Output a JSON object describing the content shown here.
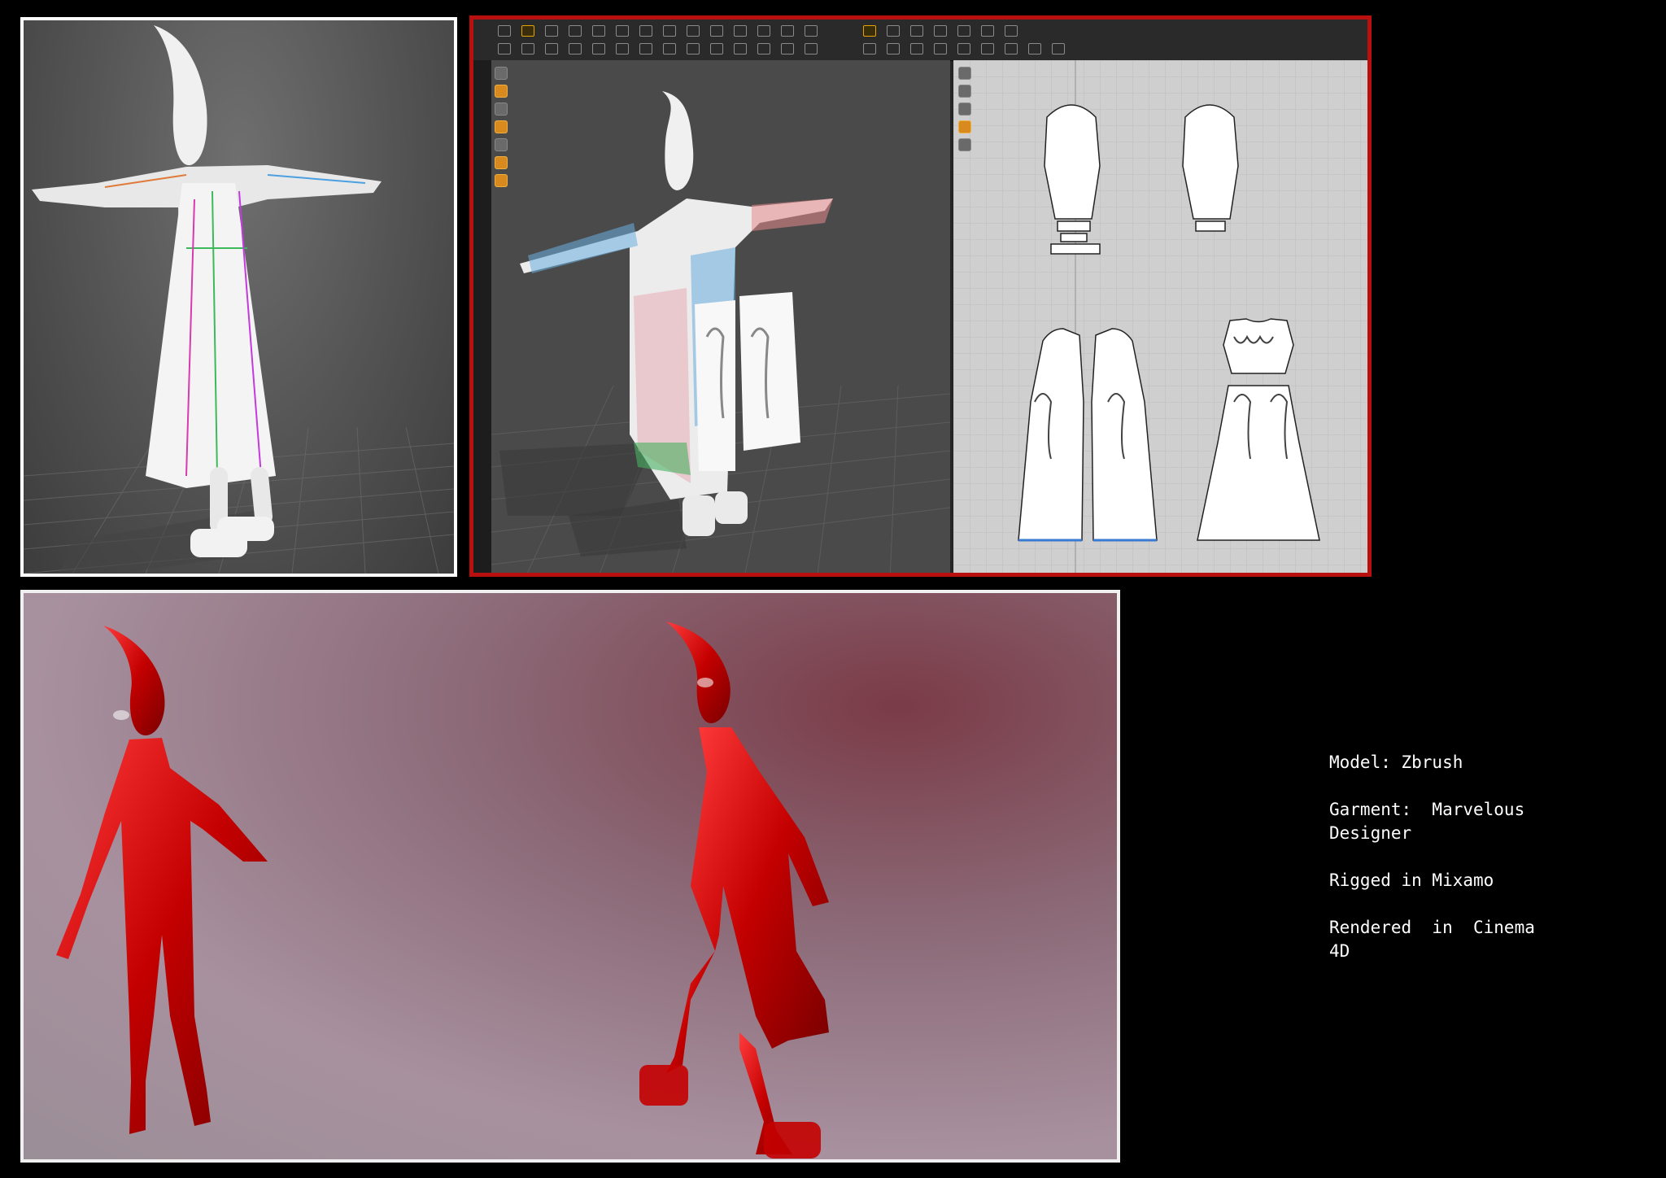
{
  "credits": {
    "model": "Model: Zbrush",
    "garment": "Garment:  Marvelous\nDesigner",
    "rigged": "Rigged in Mixamo",
    "rendered": "Rendered  in  Cinema\n4D"
  },
  "colors": {
    "page_background": "#000000",
    "frame_white": "#ffffff",
    "frame_red": "#b80f0f",
    "render_red": "#c40000",
    "toolbar_accent": "#e6a400"
  },
  "icons": [
    "3d-view-tool-icon",
    "2d-pattern-tool-icon",
    "toolbar-tool-icon"
  ]
}
